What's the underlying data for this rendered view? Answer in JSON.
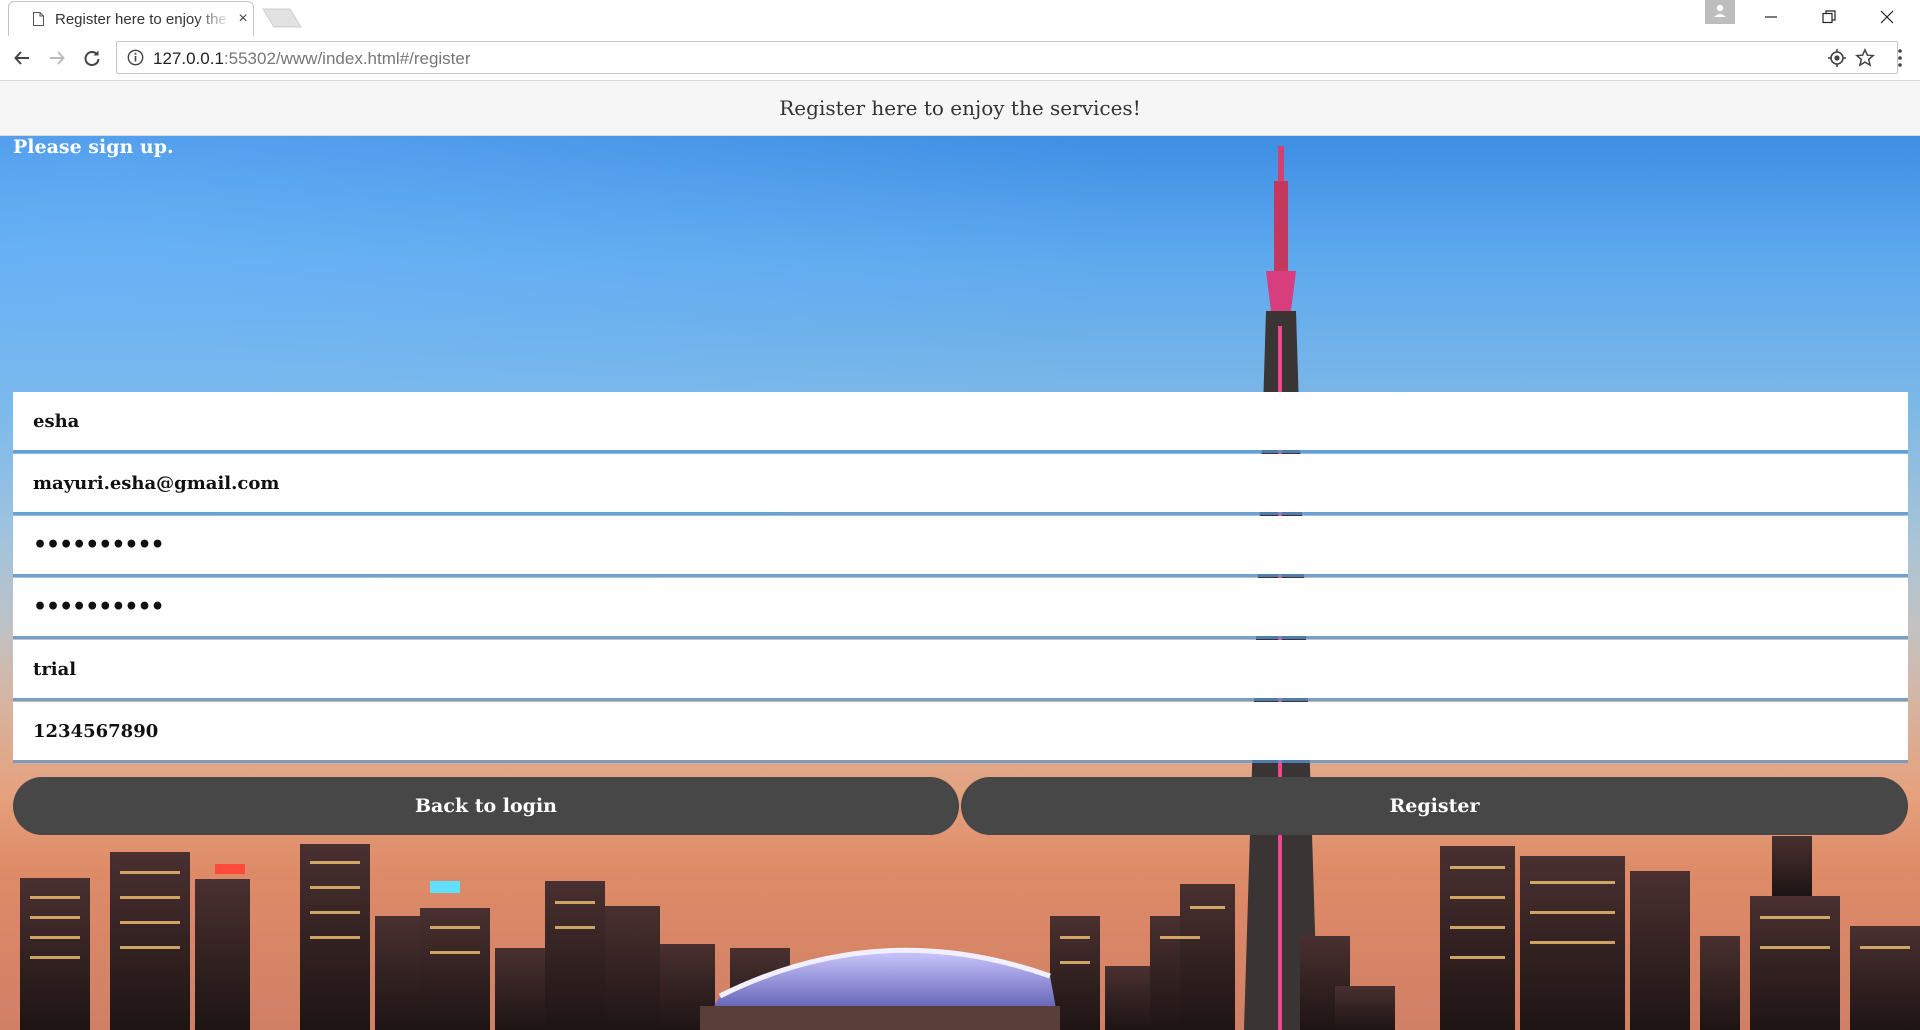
{
  "browser": {
    "tab_title": "Register here to enjoy the services!",
    "tab_close": "×",
    "url_host": "127.0.0.1",
    "url_path": ":55302/www/index.html#/register"
  },
  "header": {
    "title": "Register here to enjoy the services!"
  },
  "form": {
    "prompt": "Please sign up.",
    "name": "esha",
    "email": "mayuri.esha@gmail.com",
    "password": "••••••••••",
    "confirm_password": "••••••••••",
    "username": "trial",
    "phone": "1234567890"
  },
  "buttons": {
    "back": "Back to login",
    "register": "Register"
  },
  "colors": {
    "header_bg": "#f6f6f6",
    "button_bg": "#474747",
    "sky_top": "#3f8ee4",
    "sky_bottom": "#d08065"
  }
}
